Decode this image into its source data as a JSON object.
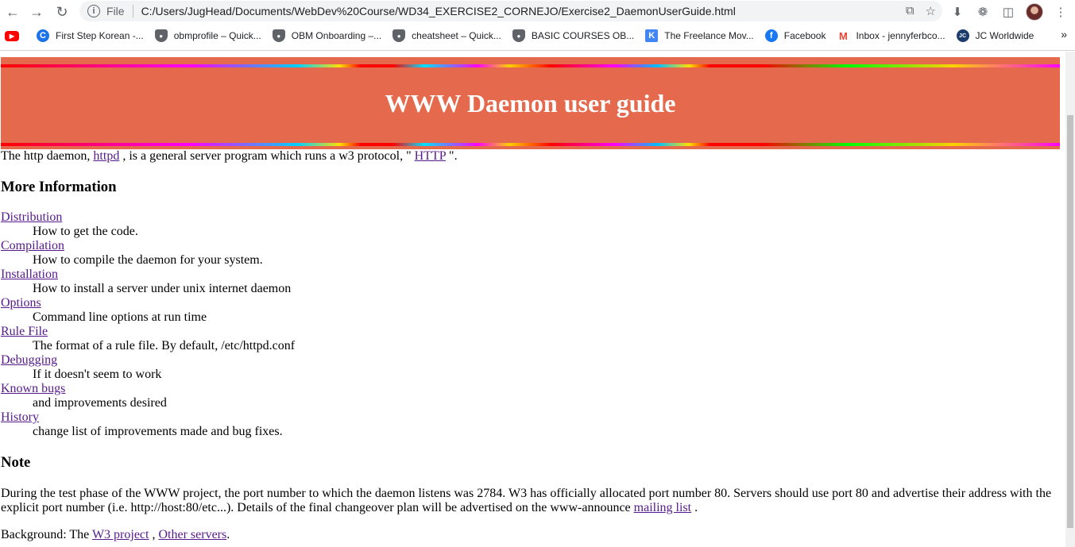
{
  "browser": {
    "file_label": "File",
    "url": "C:/Users/JugHead/Documents/WebDev%20Course/WD34_EXERCISE2_CORNEJO/Exercise2_DaemonUserGuide.html",
    "bookmarks": [
      {
        "label": "",
        "icon": "youtube-icon"
      },
      {
        "label": "First Step Korean -...",
        "icon": "coursera-icon"
      },
      {
        "label": "obmprofile – Quick...",
        "icon": "shield-icon"
      },
      {
        "label": "OBM Onboarding –...",
        "icon": "shield-icon"
      },
      {
        "label": "cheatsheet – Quick...",
        "icon": "shield-icon"
      },
      {
        "label": "BASIC COURSES OB...",
        "icon": "shield-icon"
      },
      {
        "label": "The Freelance Mov...",
        "icon": "kajabi-icon"
      },
      {
        "label": "Facebook",
        "icon": "facebook-icon"
      },
      {
        "label": "Inbox - jennyferbco...",
        "icon": "gmail-icon"
      },
      {
        "label": "JC Worldwide",
        "icon": "jc-icon"
      }
    ],
    "more_bookmarks": "»"
  },
  "page": {
    "title": "WWW Daemon user guide",
    "intro": {
      "before": "The http daemon, ",
      "link1": "httpd",
      "middle": " , is a general server program which runs a w3 protocol, \" ",
      "link2": "HTTP",
      "after": " \"."
    },
    "more_heading": "More Information",
    "items": [
      {
        "term": "Distribution",
        "desc": "How to get the code."
      },
      {
        "term": "Compilation",
        "desc": "How to compile the daemon for your system."
      },
      {
        "term": "Installation",
        "desc": "How to install a server under unix internet daemon"
      },
      {
        "term": "Options",
        "desc": "Command line options at run time"
      },
      {
        "term": "Rule File",
        "desc": "The format of a rule file. By default, /etc/httpd.conf"
      },
      {
        "term": "Debugging",
        "desc": "If it doesn't seem to work"
      },
      {
        "term": "Known bugs",
        "desc": "and improvements desired"
      },
      {
        "term": "History",
        "desc": "change list of improvements made and bug fixes."
      }
    ],
    "note_heading": "Note",
    "note": {
      "text": "During the test phase of the WWW project, the port number to which the daemon listens was 2784. W3 has officially allocated port number 80. Servers should use port 80 and advertise their address with the explicit port number (i.e. http://host:80/etc...). Details of the final changeover plan will be advertised on the www-announce ",
      "link": "mailing list",
      "after": " ."
    },
    "background": {
      "before": "Background: The ",
      "link1": "W3 project",
      "middle": " , ",
      "link2": "Other servers",
      "after": "."
    }
  }
}
